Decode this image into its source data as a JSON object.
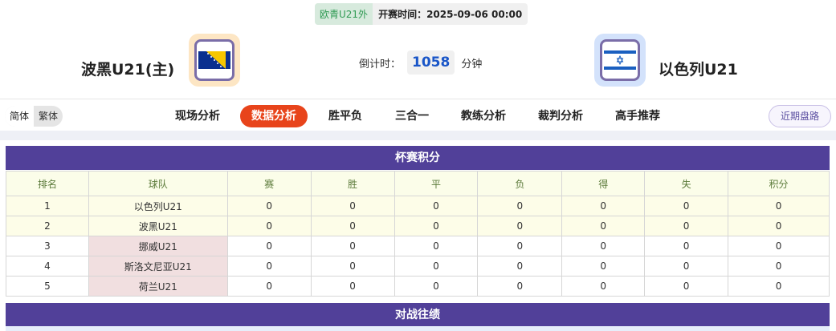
{
  "match": {
    "league": "欧青U21外",
    "kickoff": "开赛时间：2025-09-06 00:00",
    "home": "波黑U21(主)",
    "away": "以色列U21",
    "countdown_label": "倒计时：",
    "countdown_value": "1058",
    "countdown_unit": "分钟"
  },
  "lang": {
    "simplified": "简体",
    "traditional": "繁体"
  },
  "tabs": [
    {
      "label": "现场分析"
    },
    {
      "label": "数据分析",
      "active": true
    },
    {
      "label": "胜平负"
    },
    {
      "label": "三合一"
    },
    {
      "label": "教练分析"
    },
    {
      "label": "裁判分析"
    },
    {
      "label": "高手推荐"
    }
  ],
  "recent_button": "近期盘路",
  "standings": {
    "title": "杯赛积分",
    "headers": [
      "排名",
      "球队",
      "赛",
      "胜",
      "平",
      "负",
      "得",
      "失",
      "积分"
    ],
    "rows": [
      [
        "1",
        "以色列U21",
        "0",
        "0",
        "0",
        "0",
        "0",
        "0",
        "0"
      ],
      [
        "2",
        "波黑U21",
        "0",
        "0",
        "0",
        "0",
        "0",
        "0",
        "0"
      ],
      [
        "3",
        "挪威U21",
        "0",
        "0",
        "0",
        "0",
        "0",
        "0",
        "0"
      ],
      [
        "4",
        "斯洛文尼亚U21",
        "0",
        "0",
        "0",
        "0",
        "0",
        "0",
        "0"
      ],
      [
        "5",
        "荷兰U21",
        "0",
        "0",
        "0",
        "0",
        "0",
        "0",
        "0"
      ]
    ]
  },
  "h2h": {
    "title": "对战往绩"
  },
  "colors": {
    "accent": "#514099",
    "active_tab": "#e8441b",
    "countdown": "#1a56c8"
  }
}
